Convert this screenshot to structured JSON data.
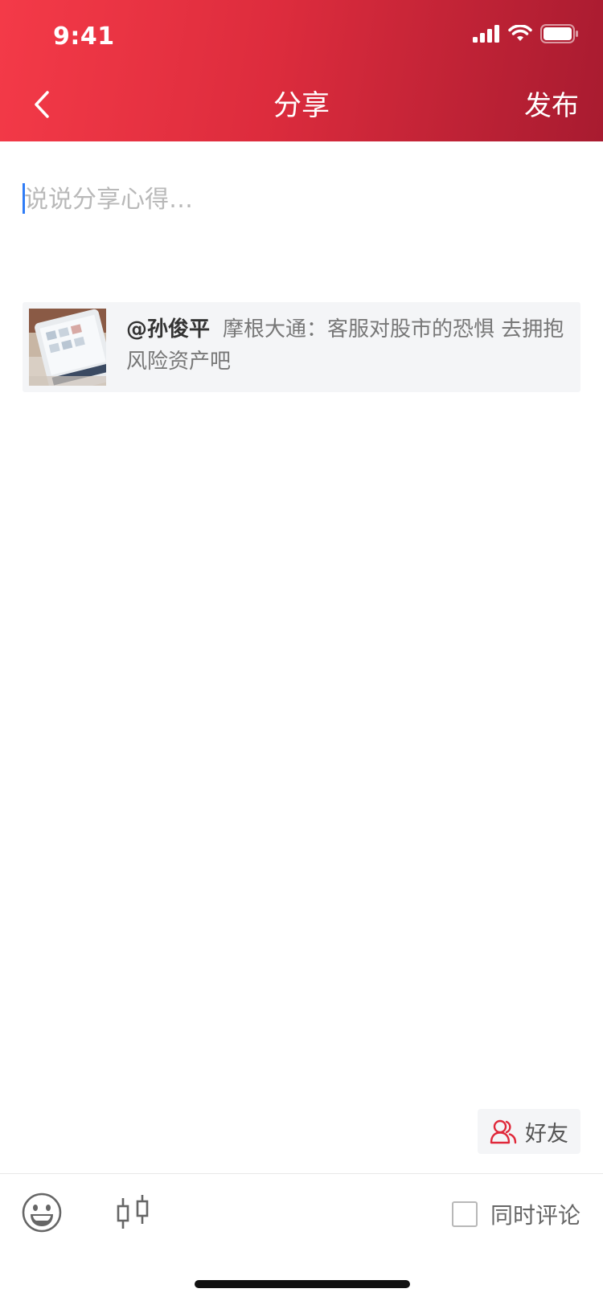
{
  "status_bar": {
    "time": "9:41"
  },
  "nav": {
    "title": "分享",
    "publish_label": "发布"
  },
  "compose": {
    "placeholder": "说说分享心得…"
  },
  "share_card": {
    "author": "@孙俊平",
    "title": "摩根大通：客服对股市的恐惧  去拥抱风险资产吧"
  },
  "friends_button": {
    "label": "好友"
  },
  "toolbar": {
    "comment_label": "同时评论",
    "comment_checked": false
  },
  "colors": {
    "header_gradient_start": "#f43a48",
    "header_gradient_end": "#a81b30",
    "accent_red": "#e0283a",
    "caret_blue": "#2f7cf6"
  },
  "icons": {
    "back": "chevron-left-icon",
    "signal": "cellular-signal-icon",
    "wifi": "wifi-icon",
    "battery": "battery-icon",
    "friends": "user-group-icon",
    "emoji": "emoji-smile-icon",
    "stock": "candlestick-chart-icon"
  }
}
